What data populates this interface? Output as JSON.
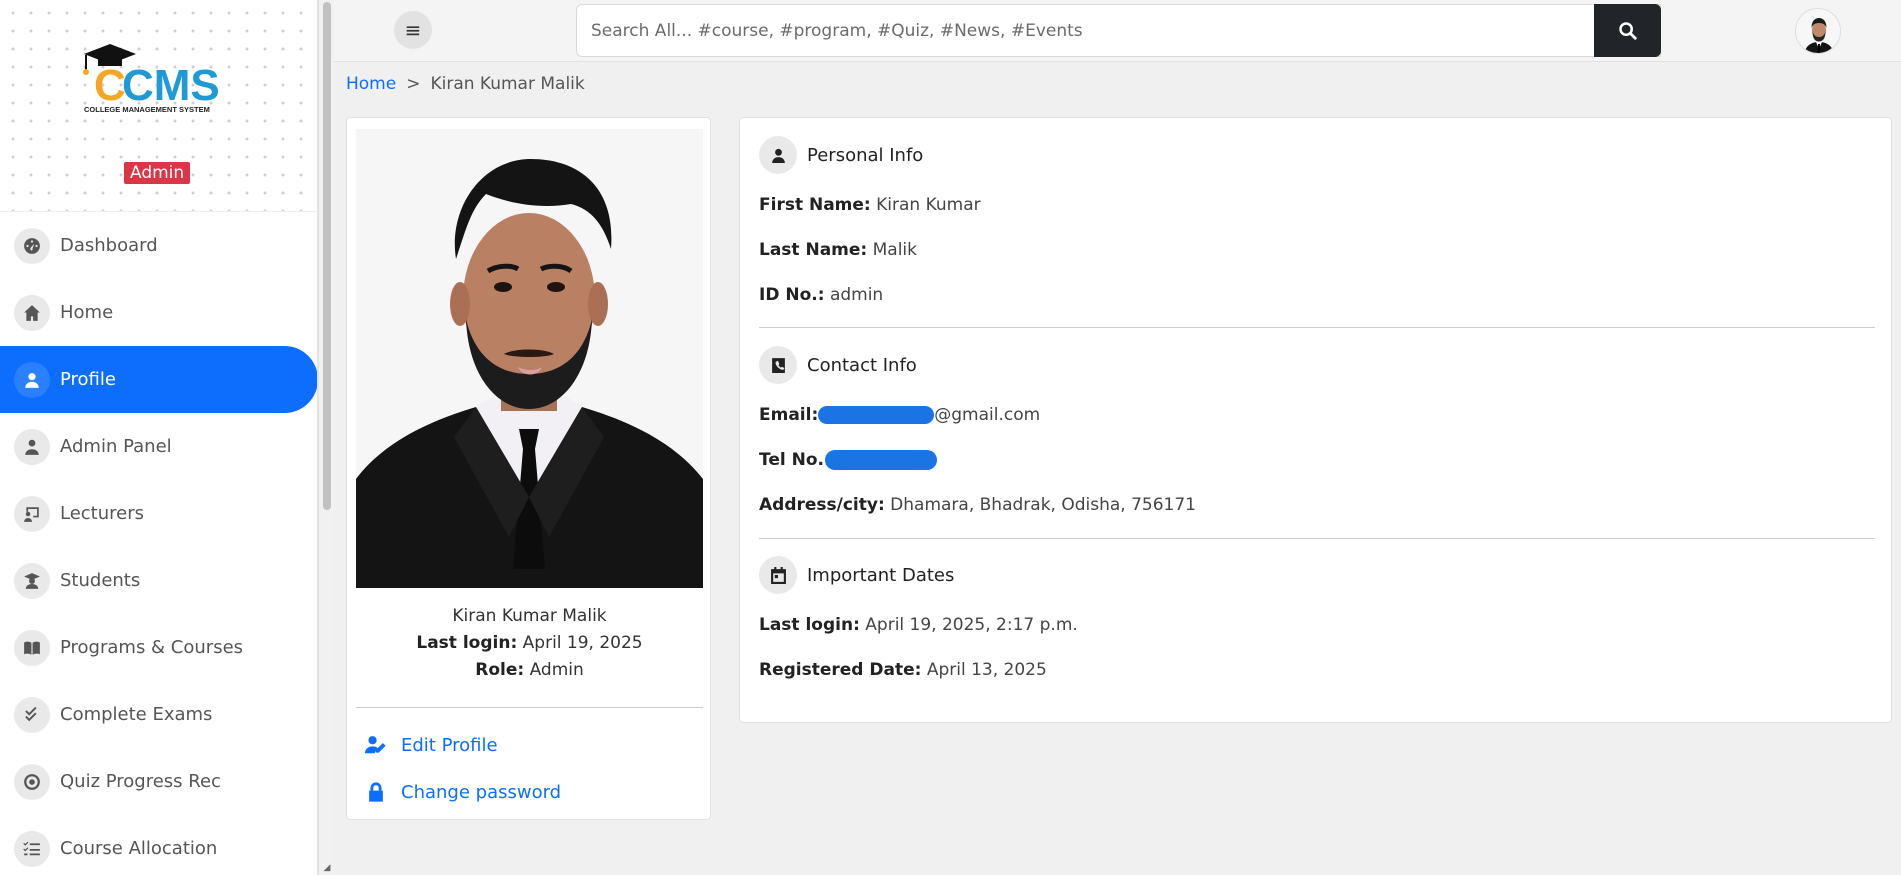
{
  "sidebar": {
    "logo_text": "CMS",
    "logo_subtitle": "COLLEGE MANAGEMENT SYSTEM",
    "role_badge": "Admin",
    "items": [
      {
        "label": "Dashboard",
        "icon": "dashboard-icon"
      },
      {
        "label": "Home",
        "icon": "home-icon"
      },
      {
        "label": "Profile",
        "icon": "user-icon",
        "active": true
      },
      {
        "label": "Admin Panel",
        "icon": "admin-icon"
      },
      {
        "label": "Lecturers",
        "icon": "lecturer-icon"
      },
      {
        "label": "Students",
        "icon": "student-icon"
      },
      {
        "label": "Programs & Courses",
        "icon": "book-icon"
      },
      {
        "label": "Complete Exams",
        "icon": "check-icon"
      },
      {
        "label": "Quiz Progress Rec",
        "icon": "record-icon"
      },
      {
        "label": "Course Allocation",
        "icon": "list-icon"
      }
    ]
  },
  "topbar": {
    "search_placeholder": "Search All... #course, #program, #Quiz, #News, #Events"
  },
  "breadcrumb": {
    "home": "Home",
    "separator": ">",
    "current": "Kiran Kumar Malik"
  },
  "profile_card": {
    "name": "Kiran Kumar Malik",
    "last_login_label": "Last login:",
    "last_login_value": "April 19, 2025",
    "role_label": "Role:",
    "role_value": "Admin",
    "edit_profile": "Edit Profile",
    "change_password": "Change password"
  },
  "personal_info": {
    "title": "Personal Info",
    "first_name_label": "First Name:",
    "first_name": "Kiran Kumar",
    "last_name_label": "Last Name:",
    "last_name": "Malik",
    "id_label": "ID No.:",
    "id_value": "admin"
  },
  "contact_info": {
    "title": "Contact Info",
    "email_label": "Email:",
    "email_suffix": "@gmail.com",
    "tel_label": "Tel No.:",
    "address_label": "Address/city:",
    "address": "Dhamara, Bhadrak, Odisha, 756171"
  },
  "important_dates": {
    "title": "Important Dates",
    "last_login_label": "Last login:",
    "last_login": "April 19, 2025, 2:17 p.m.",
    "registered_label": "Registered Date:",
    "registered": "April 13, 2025"
  },
  "colors": {
    "primary": "#0d6efd",
    "danger": "#dc3545",
    "dark": "#212529"
  }
}
